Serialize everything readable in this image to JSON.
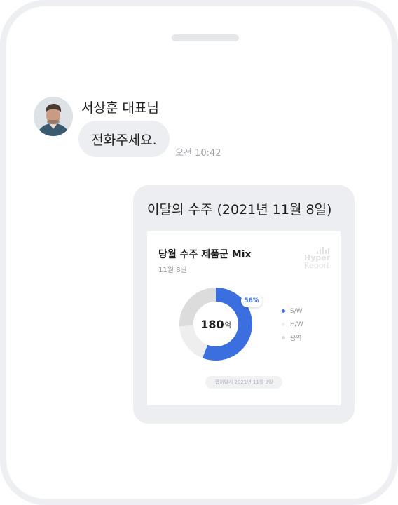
{
  "message": {
    "sender_name": "서상훈 대표님",
    "text": "전화주세요.",
    "time": "오전 10:42"
  },
  "report_card": {
    "title": "이달의 수주 (2021년 11월 8일)",
    "panel": {
      "title": "당월 수주 제품군 Mix",
      "date": "11월 8일",
      "watermark_line1": "Hyper",
      "watermark_line2": "Report",
      "center_value": "180",
      "center_unit": "억",
      "percent_badge": "56%",
      "capture_label": "캡쳐일시 2021년 11월 9일"
    }
  },
  "chart_data": {
    "type": "pie",
    "title": "당월 수주 제품군 Mix",
    "total": 180,
    "unit": "억",
    "categories": [
      "S/W",
      "H/W",
      "용역"
    ],
    "values": [
      56,
      18,
      26
    ],
    "colors": [
      "#3b6fe0",
      "#eeeeee",
      "#dcdcdc"
    ],
    "legend_position": "right",
    "style": "donut"
  }
}
